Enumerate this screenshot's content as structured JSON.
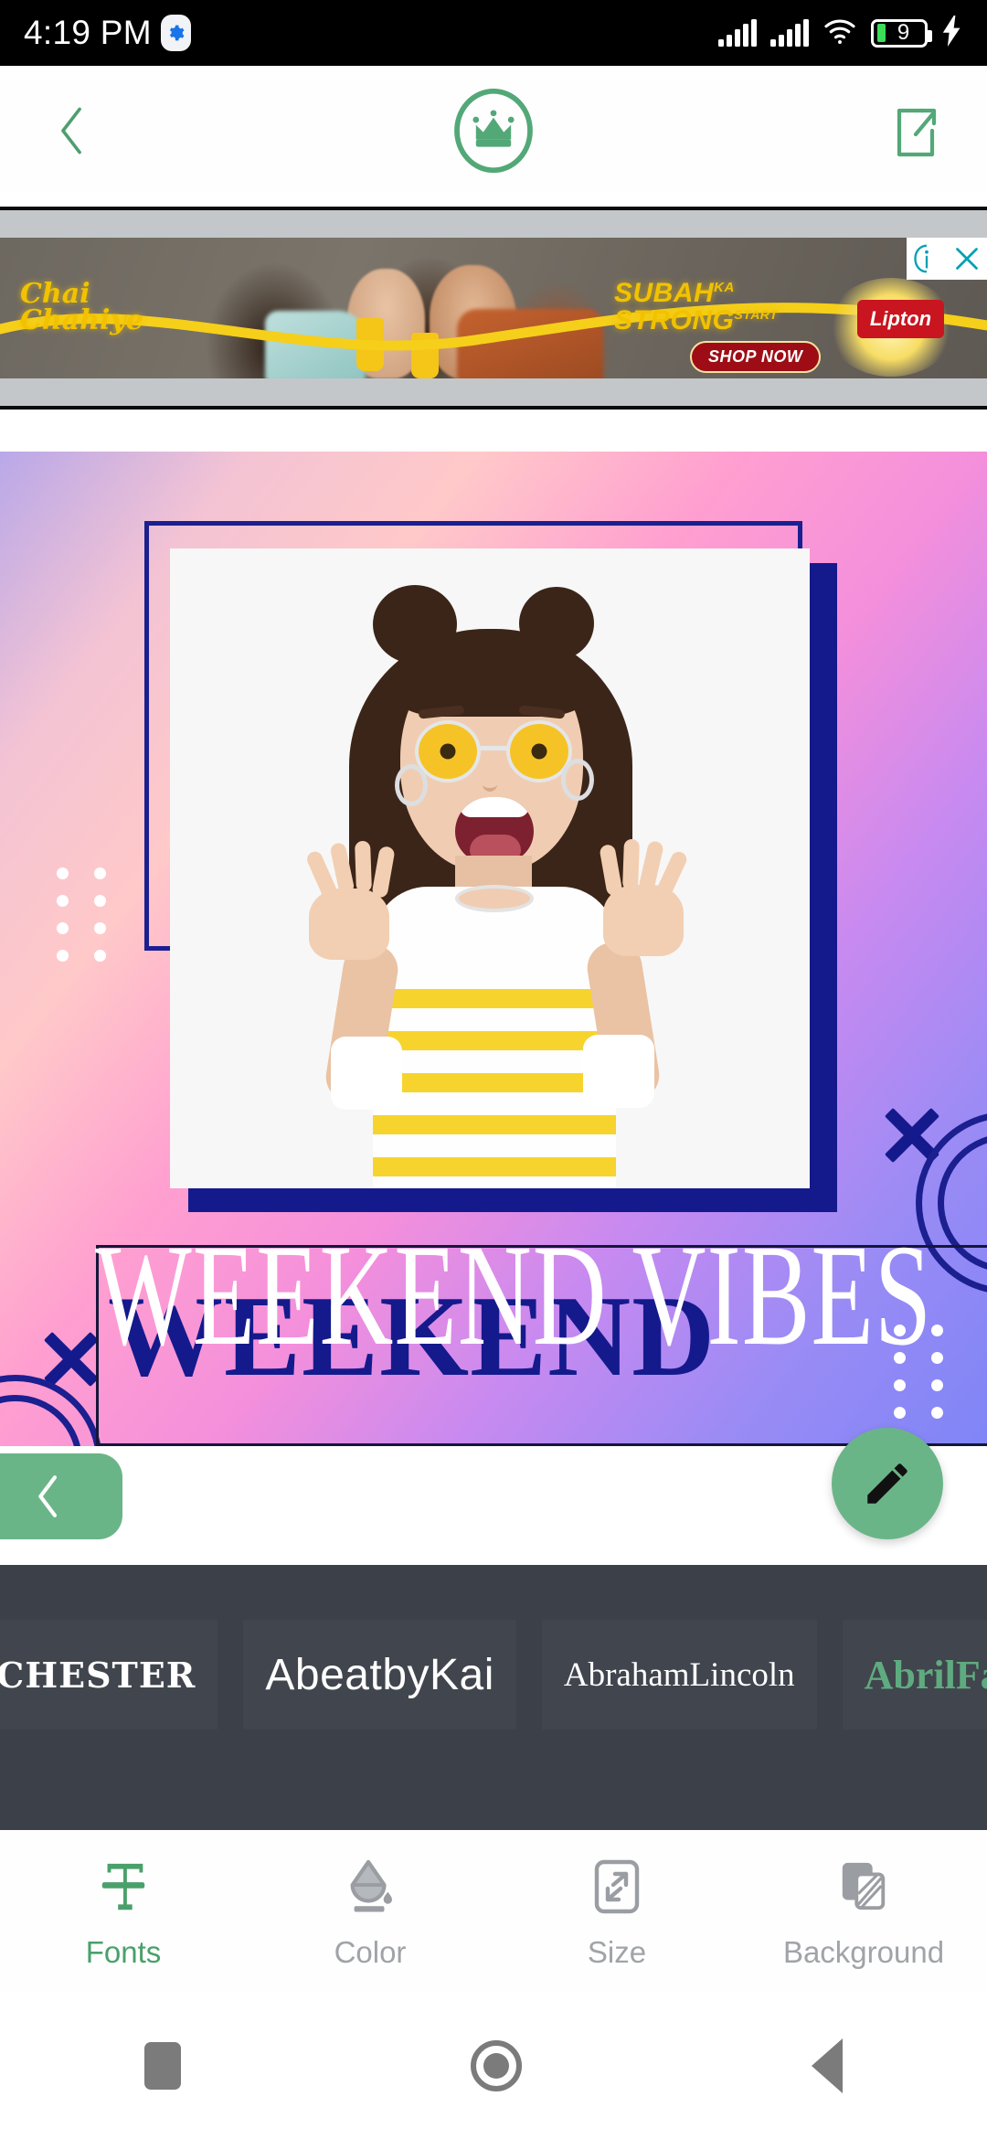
{
  "status_bar": {
    "time": "4:19 PM",
    "notification_icon": "settings-gear-icon",
    "signal_icon_1": "cellular-signal-icon",
    "signal_icon_2": "cellular-signal-icon",
    "wifi_icon": "wifi-icon",
    "battery_level": "9",
    "charging_icon": "charging-bolt-icon"
  },
  "app_header": {
    "back_icon": "back-chevron-icon",
    "logo_icon": "crown-logo-icon",
    "share_icon": "share-export-icon"
  },
  "ad": {
    "brand": "Lipton",
    "headline_line1": "Chai",
    "headline_line2": "Chahiye",
    "tagline_line1": "SUBAH",
    "tagline_sup1": "KA",
    "tagline_line2": "STRONG",
    "tagline_sup2": "START",
    "cta": "SHOP NOW",
    "info_icon": "adchoices-info-icon",
    "close_icon": "ad-close-icon"
  },
  "canvas": {
    "headline_front": "WEEKEND VIBES",
    "headline_back": "WEEKEND",
    "colors": {
      "navy": "#141a8c",
      "gradient_start": "#b9a8e8",
      "gradient_mid": "#ff9fd0",
      "gradient_end": "#7f85f7"
    },
    "decorations": [
      "dot-grid-icon",
      "x-mark-icon",
      "zigzag-squiggle-icon",
      "concentric-circles-icon"
    ]
  },
  "actions": {
    "back_icon": "back-chevron-icon",
    "edit_icon": "pencil-edit-icon",
    "accent_color": "#6ab587"
  },
  "font_strip": {
    "fonts": [
      {
        "label": "CHESTER",
        "selected": false
      },
      {
        "label": "AbeatbyKai",
        "selected": false
      },
      {
        "label": "AbrahamLincoln",
        "selected": false
      },
      {
        "label": "AbrilFatface-Regular",
        "selected": true
      }
    ]
  },
  "toolbar": {
    "items": [
      {
        "label": "Fonts",
        "icon": "text-format-icon",
        "active": true
      },
      {
        "label": "Color",
        "icon": "paint-bucket-icon",
        "active": false
      },
      {
        "label": "Size",
        "icon": "resize-icon",
        "active": false
      },
      {
        "label": "Background",
        "icon": "background-layers-icon",
        "active": false
      }
    ],
    "active_color": "#4aa06b",
    "inactive_color": "#a0a3a8"
  },
  "nav_bar": {
    "recents_icon": "recents-square-icon",
    "home_icon": "home-circle-icon",
    "back_icon": "back-triangle-icon"
  }
}
